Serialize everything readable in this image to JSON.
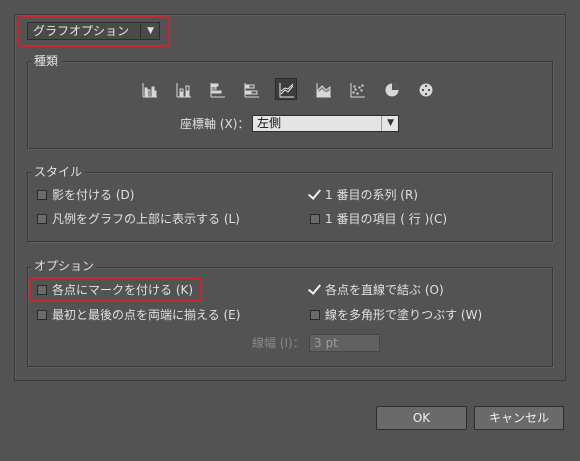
{
  "graph_option_dropdown": {
    "value": "グラフオプション"
  },
  "type_group": {
    "label": "種類",
    "chart_icons": [
      {
        "name": "grouped-column-chart-icon",
        "selected": false
      },
      {
        "name": "stacked-column-chart-icon",
        "selected": false
      },
      {
        "name": "grouped-bar-chart-icon",
        "selected": false
      },
      {
        "name": "stacked-bar-chart-icon",
        "selected": false
      },
      {
        "name": "line-chart-icon",
        "selected": true
      },
      {
        "name": "area-chart-icon",
        "selected": false
      },
      {
        "name": "scatter-chart-icon",
        "selected": false
      },
      {
        "name": "pie-chart-icon",
        "selected": false
      },
      {
        "name": "radar-chart-icon",
        "selected": false
      }
    ],
    "axis_label": "座標軸 (X)：",
    "axis_value": "左側"
  },
  "style_group": {
    "label": "スタイル",
    "options": [
      {
        "label": "影を付ける (D)",
        "checked": false
      },
      {
        "label": "1 番目の系列 (R)",
        "checked": true
      },
      {
        "label": "凡例をグラフの上部に表示する (L)",
        "checked": false
      },
      {
        "label": "1 番目の項目 ( 行 )(C)",
        "checked": false
      }
    ]
  },
  "options_group": {
    "label": "オプション",
    "options": [
      {
        "label": "各点にマークを付ける (K)",
        "checked": false
      },
      {
        "label": "各点を直線で結ぶ (O)",
        "checked": true
      },
      {
        "label": "最初と最後の点を両端に揃える (E)",
        "checked": false
      },
      {
        "label": "線を多角形で塗りつぶす (W)",
        "checked": false
      }
    ],
    "line_width_label": "線幅 (I)：",
    "line_width_value": "3 pt"
  },
  "buttons": {
    "ok": "OK",
    "cancel": "キャンセル"
  },
  "colors": {
    "background": "#535353",
    "highlight": "#c8262c"
  }
}
